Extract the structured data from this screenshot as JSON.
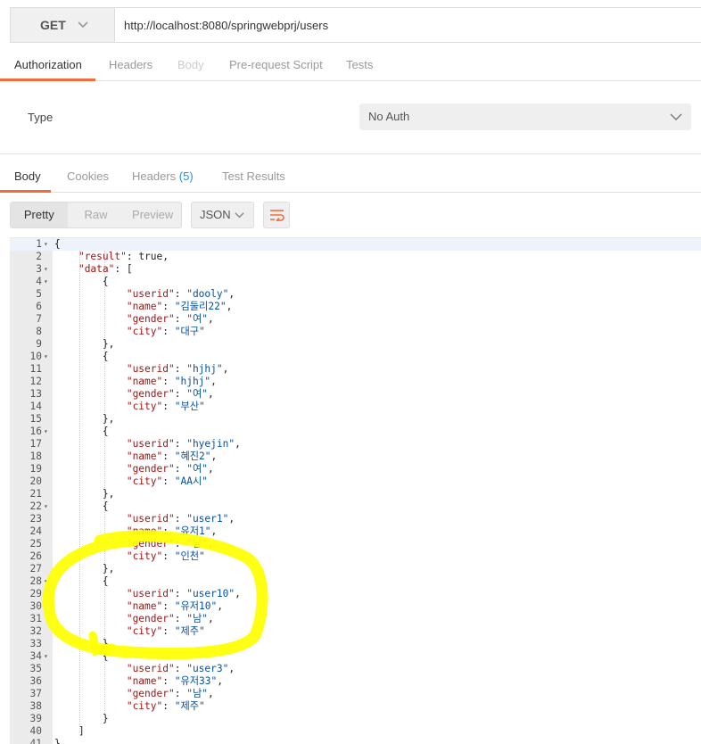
{
  "request": {
    "method": "GET",
    "url": "http://localhost:8080/springwebprj/users"
  },
  "request_tabs": [
    {
      "label": "Authorization",
      "state": "active"
    },
    {
      "label": "Headers",
      "state": "normal"
    },
    {
      "label": "Body",
      "state": "disabled"
    },
    {
      "label": "Pre-request Script",
      "state": "normal"
    },
    {
      "label": "Tests",
      "state": "normal"
    }
  ],
  "auth": {
    "type_label": "Type",
    "type_value": "No Auth"
  },
  "response_tabs": {
    "body": "Body",
    "cookies": "Cookies",
    "headers": "Headers",
    "headers_count": "(5)",
    "test_results": "Test Results"
  },
  "toolbar": {
    "view_modes": [
      "Pretty",
      "Raw",
      "Preview"
    ],
    "active_view": "Pretty",
    "format": "JSON"
  },
  "accent_color": "#f26b3a",
  "highlight_color": "#ffff00",
  "code_lines": [
    {
      "n": "1",
      "fold": true,
      "t": "{"
    },
    {
      "n": "2",
      "t": "    \"result\": true,"
    },
    {
      "n": "3",
      "fold": true,
      "t": "    \"data\": ["
    },
    {
      "n": "4",
      "fold": true,
      "t": "        {"
    },
    {
      "n": "5",
      "t": "            \"userid\": \"dooly\","
    },
    {
      "n": "6",
      "t": "            \"name\": \"김둘리22\","
    },
    {
      "n": "7",
      "t": "            \"gender\": \"여\","
    },
    {
      "n": "8",
      "t": "            \"city\": \"대구\""
    },
    {
      "n": "9",
      "t": "        },"
    },
    {
      "n": "10",
      "fold": true,
      "t": "        {"
    },
    {
      "n": "11",
      "t": "            \"userid\": \"hjhj\","
    },
    {
      "n": "12",
      "t": "            \"name\": \"hjhj\","
    },
    {
      "n": "13",
      "t": "            \"gender\": \"여\","
    },
    {
      "n": "14",
      "t": "            \"city\": \"부산\""
    },
    {
      "n": "15",
      "t": "        },"
    },
    {
      "n": "16",
      "fold": true,
      "t": "        {"
    },
    {
      "n": "17",
      "t": "            \"userid\": \"hyejin\","
    },
    {
      "n": "18",
      "t": "            \"name\": \"혜진2\","
    },
    {
      "n": "19",
      "t": "            \"gender\": \"여\","
    },
    {
      "n": "20",
      "t": "            \"city\": \"AA시\""
    },
    {
      "n": "21",
      "t": "        },"
    },
    {
      "n": "22",
      "fold": true,
      "t": "        {"
    },
    {
      "n": "23",
      "t": "            \"userid\": \"user1\","
    },
    {
      "n": "24",
      "t": "            \"name\": \"유저1\","
    },
    {
      "n": "25",
      "t": "            \"gender\": \"남\","
    },
    {
      "n": "26",
      "t": "            \"city\": \"인천\""
    },
    {
      "n": "27",
      "t": "        },"
    },
    {
      "n": "28",
      "fold": true,
      "t": "        {"
    },
    {
      "n": "29",
      "t": "            \"userid\": \"user10\","
    },
    {
      "n": "30",
      "t": "            \"name\": \"유저10\","
    },
    {
      "n": "31",
      "t": "            \"gender\": \"남\","
    },
    {
      "n": "32",
      "t": "            \"city\": \"제주\""
    },
    {
      "n": "33",
      "t": "        },"
    },
    {
      "n": "34",
      "fold": true,
      "t": "        {"
    },
    {
      "n": "35",
      "t": "            \"userid\": \"user3\","
    },
    {
      "n": "36",
      "t": "            \"name\": \"유저33\","
    },
    {
      "n": "37",
      "t": "            \"gender\": \"남\","
    },
    {
      "n": "38",
      "t": "            \"city\": \"제주\""
    },
    {
      "n": "39",
      "t": "        }"
    },
    {
      "n": "40",
      "t": "    ]"
    },
    {
      "n": "41",
      "t": "}"
    }
  ]
}
